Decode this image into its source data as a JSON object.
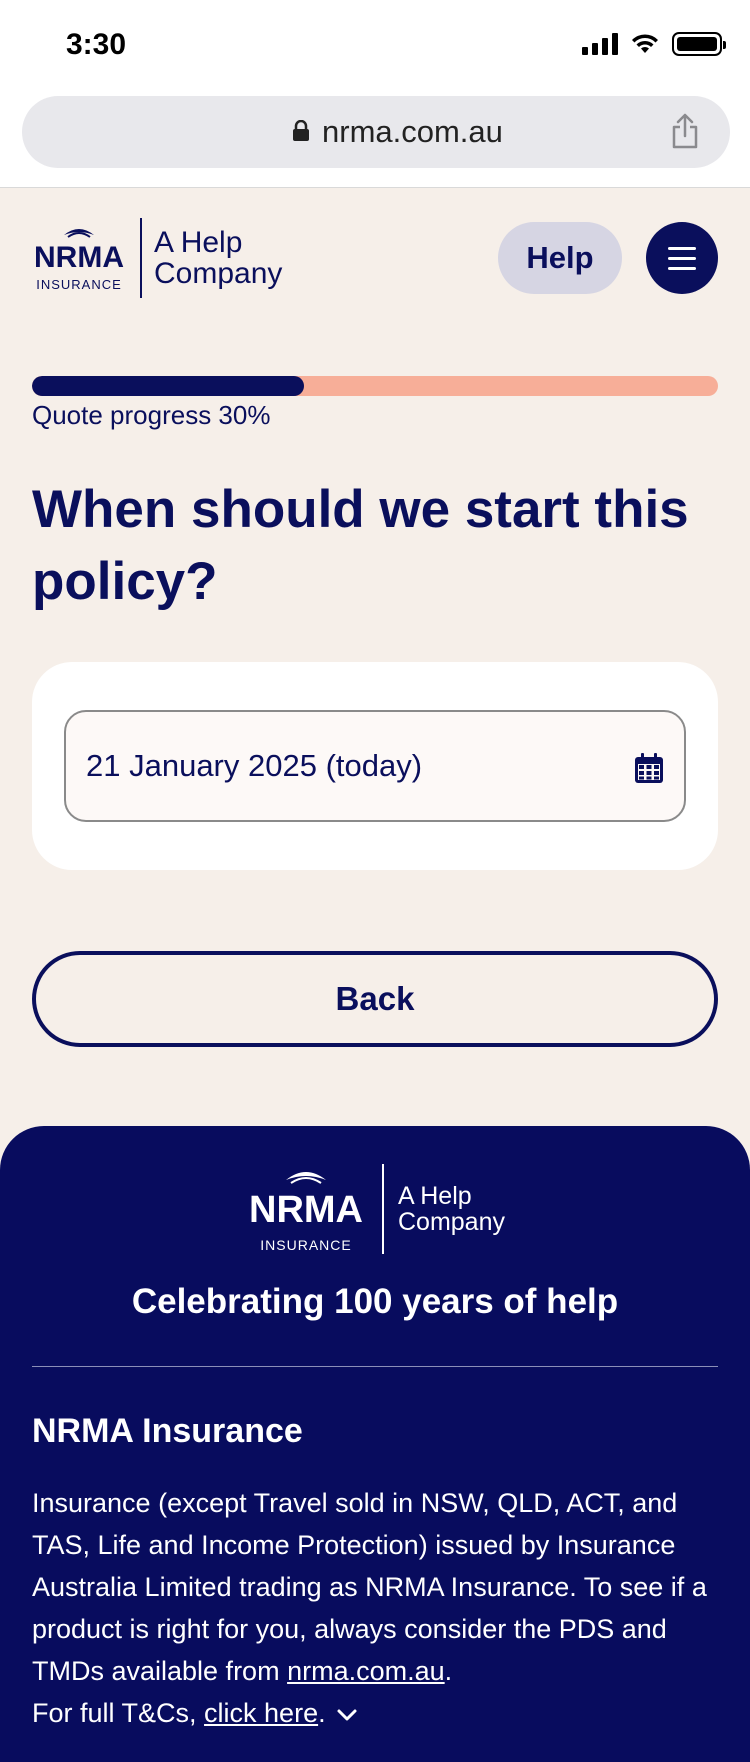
{
  "status_bar": {
    "time": "3:30"
  },
  "browser": {
    "url": "nrma.com.au"
  },
  "header": {
    "brand": "NRMA",
    "brand_sub": "INSURANCE",
    "tagline_line1": "A Help",
    "tagline_line2": "Company",
    "help_label": "Help"
  },
  "progress": {
    "percent": 30,
    "label": "Quote progress 30%"
  },
  "question": "When should we start this policy?",
  "date_field": {
    "value": "21 January 2025 (today)"
  },
  "back_label": "Back",
  "footer": {
    "brand": "NRMA",
    "brand_sub": "INSURANCE",
    "tagline_line1": "A Help",
    "tagline_line2": "Company",
    "celebration": "Celebrating 100 years of help",
    "heading": "NRMA Insurance",
    "disclaimer": "Insurance (except Travel sold in NSW, QLD, ACT, and TAS, Life and Income Protection) issued by Insurance Australia Limited trading as NRMA Insurance. To see if a product is right for you, always consider the PDS and TMDs available from ",
    "disclaimer_link": "nrma.com.au",
    "disclaimer_end": ".",
    "tcs_prefix": "For full T&Cs, ",
    "tcs_link": "click here",
    "tcs_end": "."
  },
  "colors": {
    "navy": "#0a0f5c",
    "footer_navy": "#080c5e",
    "progress_remaining": "#f7ae98",
    "background": "#f6efe9"
  }
}
